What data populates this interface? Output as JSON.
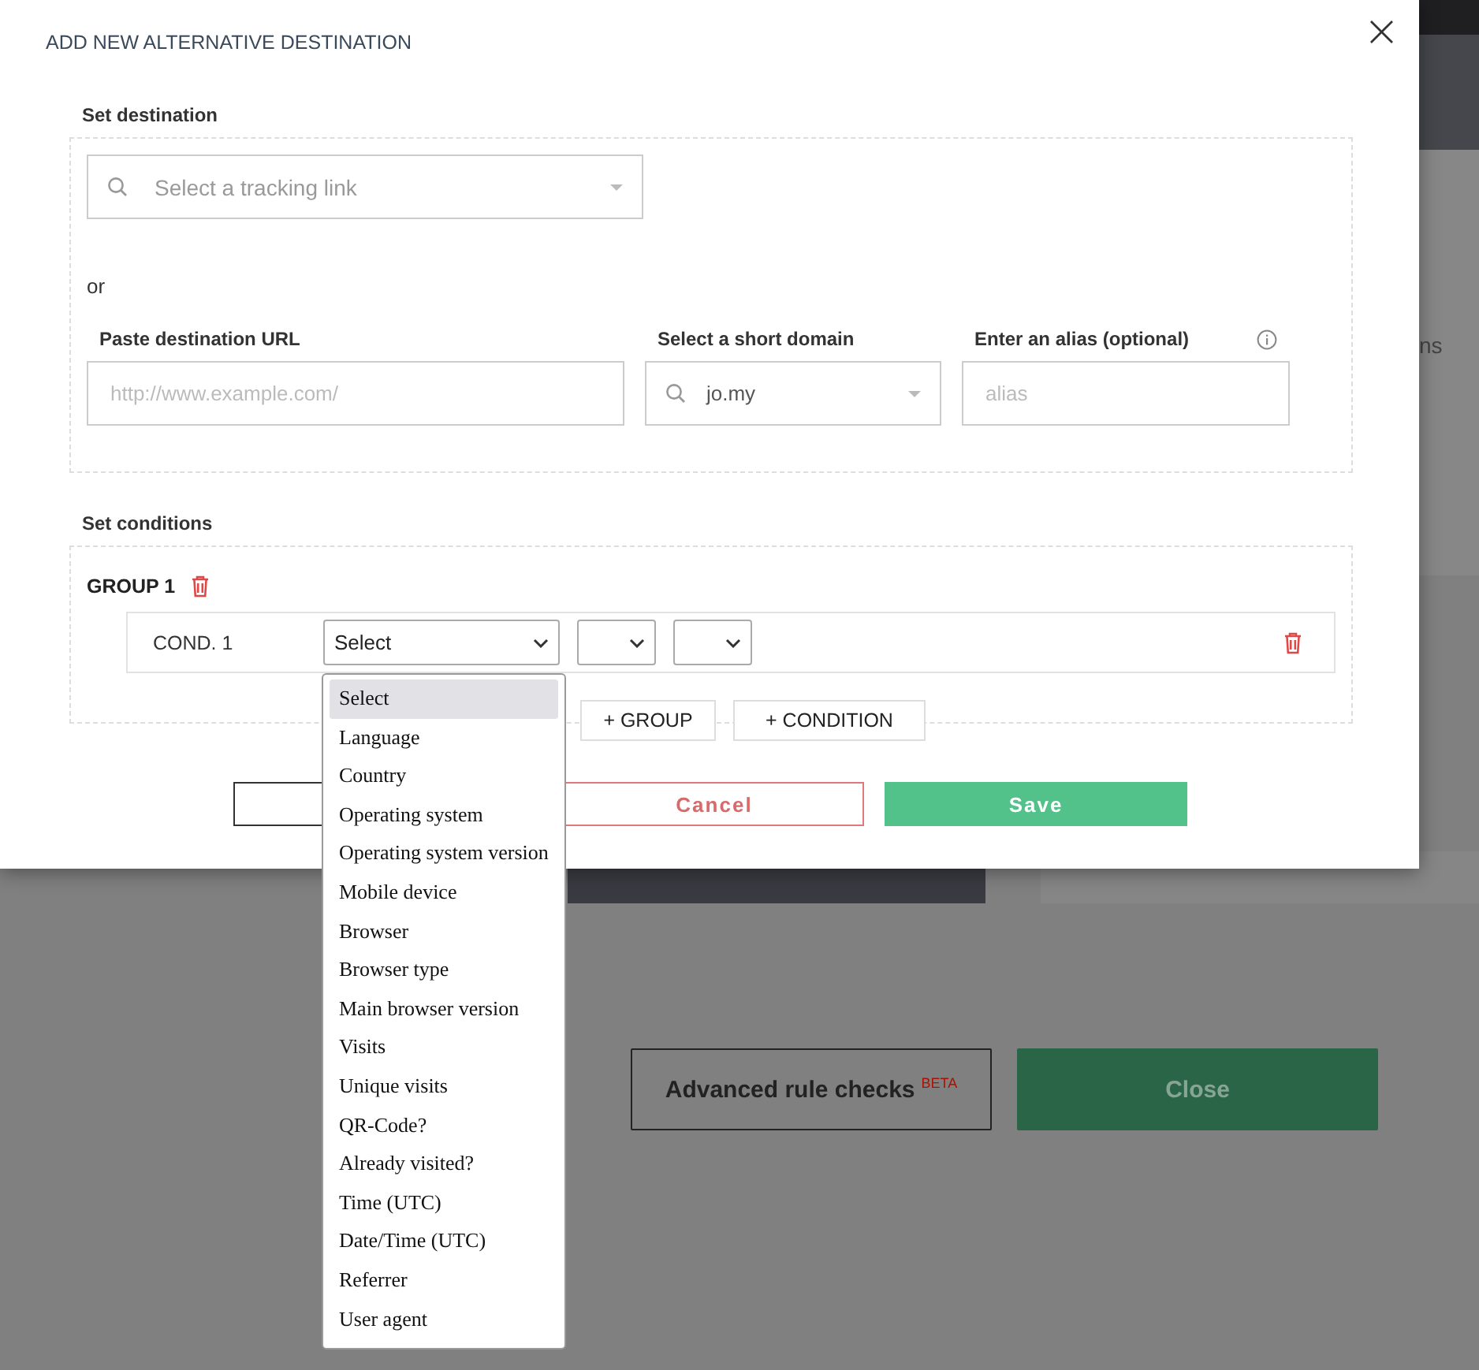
{
  "background": {
    "side_text": "ns",
    "buttons": [
      {
        "label": "Advanced rule checks",
        "badge": "BETA",
        "kind": "outline"
      },
      {
        "label": "Close",
        "kind": "primary"
      }
    ]
  },
  "dialog": {
    "title": "ADD NEW ALTERNATIVE DESTINATION",
    "close": "×",
    "destination": {
      "heading": "Set destination",
      "tracking_link": {
        "placeholder": "Select a tracking link"
      },
      "or": "or",
      "url": {
        "label": "Paste destination URL",
        "placeholder": "http://www.example.com/"
      },
      "domain": {
        "label": "Select a short domain",
        "value": "jo.my"
      },
      "alias": {
        "label": "Enter an alias (optional)",
        "placeholder": "alias"
      }
    },
    "conditions": {
      "heading": "Set conditions",
      "groups": [
        {
          "title": "GROUP 1",
          "conditions": [
            {
              "label": "COND. 1",
              "field": "Select"
            }
          ]
        }
      ],
      "add_buttons": [
        "+ GROUP",
        "+ CONDITION"
      ]
    },
    "footer": {
      "cancel": "Cancel",
      "save": "Save"
    }
  },
  "dropdown": {
    "options": [
      {
        "label": "Select",
        "selected": true
      },
      {
        "label": "Language",
        "selected": false
      },
      {
        "label": "Country",
        "selected": false
      },
      {
        "label": "Operating system",
        "selected": false
      },
      {
        "label": "Operating system version",
        "selected": false
      },
      {
        "label": "Mobile device",
        "selected": false
      },
      {
        "label": "Browser",
        "selected": false
      },
      {
        "label": "Browser type",
        "selected": false
      },
      {
        "label": "Main browser version",
        "selected": false
      },
      {
        "label": "Visits",
        "selected": false
      },
      {
        "label": "Unique visits",
        "selected": false
      },
      {
        "label": "QR-Code?",
        "selected": false
      },
      {
        "label": "Already visited?",
        "selected": false
      },
      {
        "label": "Time (UTC)",
        "selected": false
      },
      {
        "label": "Date/Time (UTC)",
        "selected": false
      },
      {
        "label": "Referrer",
        "selected": false
      },
      {
        "label": "User agent",
        "selected": false
      }
    ]
  }
}
